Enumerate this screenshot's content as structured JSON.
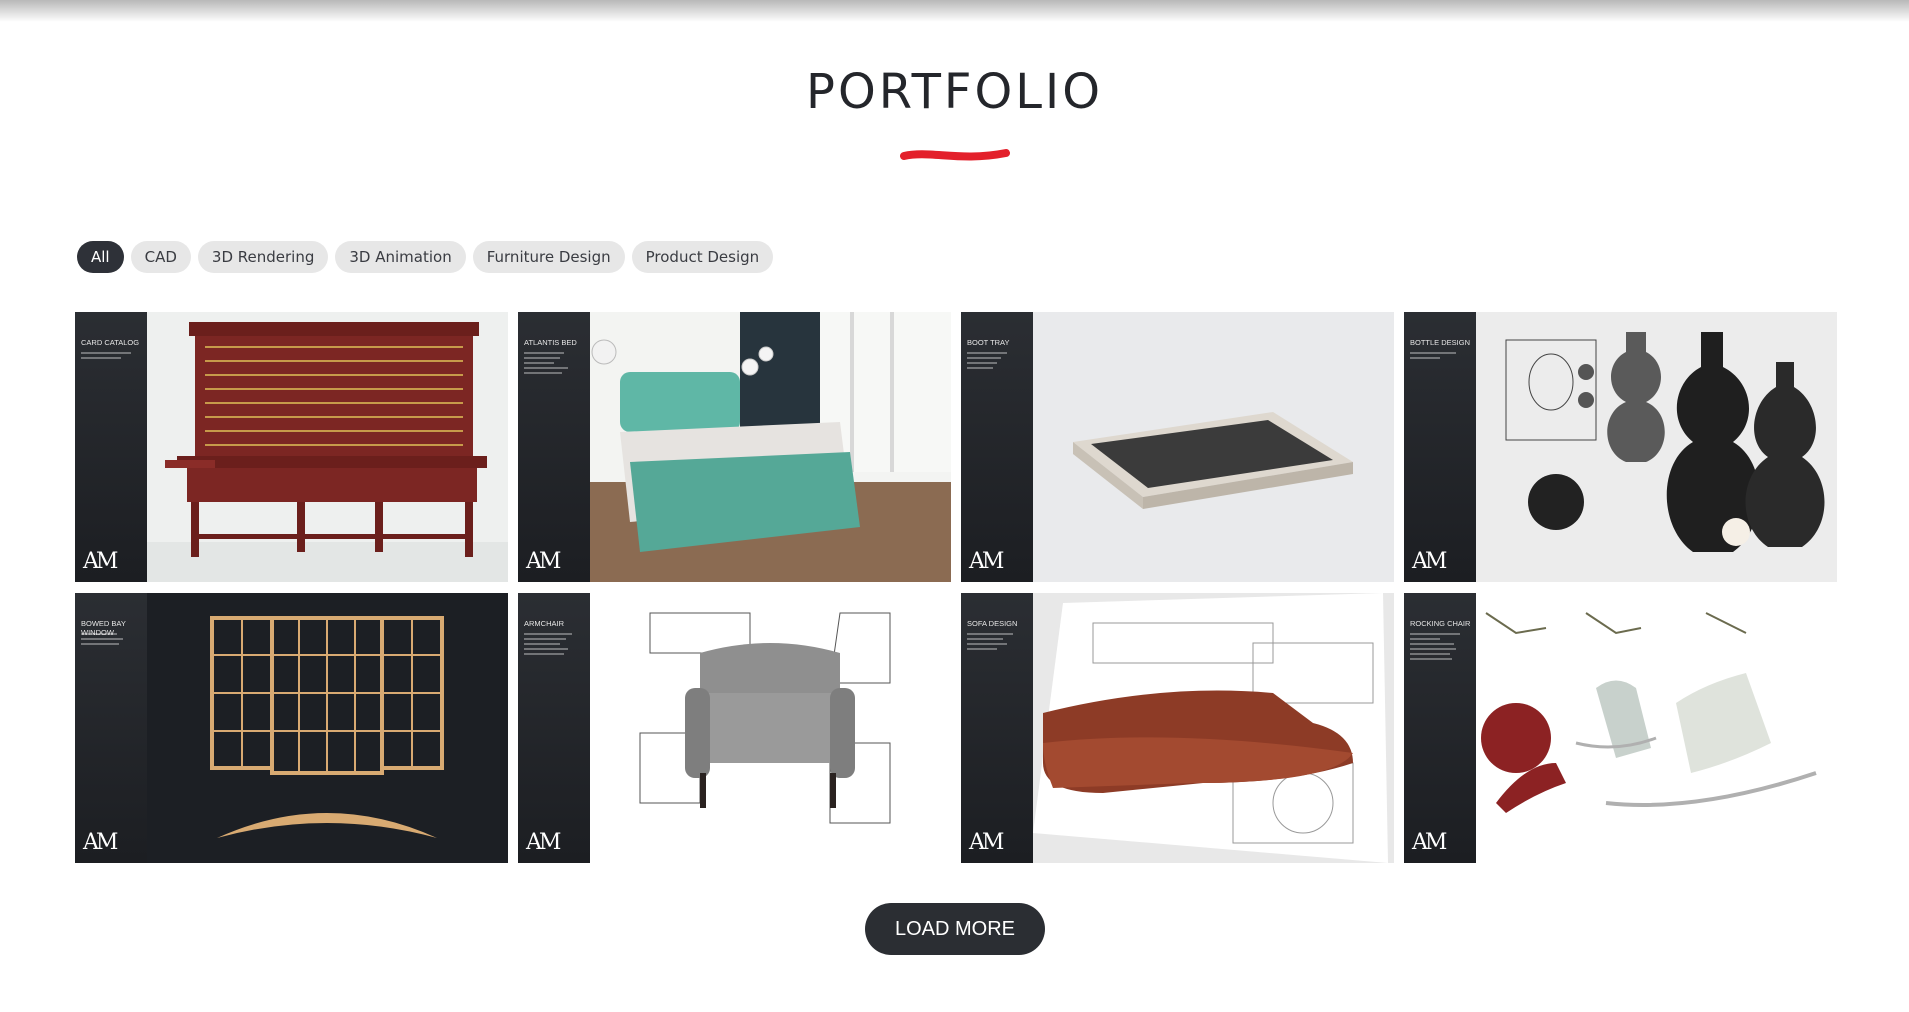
{
  "page": {
    "title": "PORTFOLIO"
  },
  "filters": [
    {
      "label": "All",
      "active": true
    },
    {
      "label": "CAD",
      "active": false
    },
    {
      "label": "3D Rendering",
      "active": false
    },
    {
      "label": "3D Animation",
      "active": false
    },
    {
      "label": "Furniture Design",
      "active": false
    },
    {
      "label": "Product Design",
      "active": false
    }
  ],
  "items": [
    {
      "title": "CARD CATALOG"
    },
    {
      "title": "ATLANTIS BED"
    },
    {
      "title": "BOOT TRAY"
    },
    {
      "title": "BOTTLE DESIGN"
    },
    {
      "title": "BOWED BAY WINDOW"
    },
    {
      "title": "ARMCHAIR"
    },
    {
      "title": "SOFA DESIGN"
    },
    {
      "title": "ROCKING CHAIR"
    }
  ],
  "logo_text": "AM",
  "load_more": "LOAD MORE",
  "colors": {
    "accent": "#e3202b",
    "dark": "#2b2e33",
    "chip": "#e7e7e7"
  }
}
